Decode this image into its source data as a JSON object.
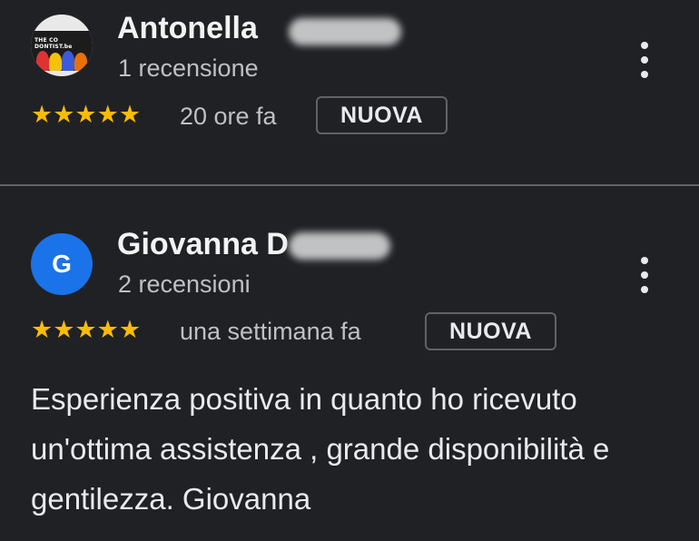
{
  "reviews": [
    {
      "name": "Antonella",
      "count": "1 recensione",
      "stars": "★★★★★",
      "time": "20 ore fa",
      "badge": "NUOVA",
      "avatar_text": "THE CO DONTIST.be",
      "text": ""
    },
    {
      "name": "Giovanna D",
      "count": "2 recensioni",
      "stars": "★★★★★",
      "time": "una settimana fa",
      "badge": "NUOVA",
      "avatar_letter": "G",
      "text": "Esperienza positiva in quanto ho ricevuto un'ottima assistenza , grande disponibilità e gentilezza. Giovanna"
    }
  ],
  "colors": {
    "background": "#202124",
    "star": "#fbbc04",
    "avatar_blue": "#1a73e8",
    "divider": "#5f6368"
  },
  "icons": [
    "more-vert-icon",
    "star-icon"
  ]
}
